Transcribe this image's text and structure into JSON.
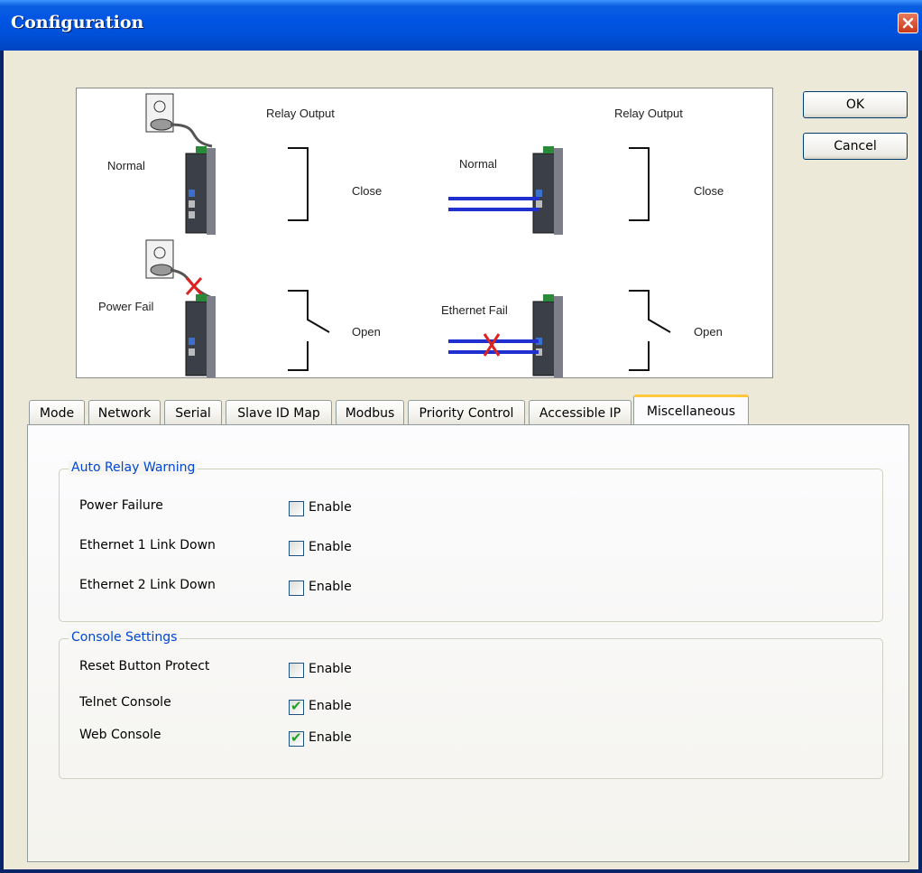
{
  "window": {
    "title": "Configuration",
    "close_icon": "close-icon"
  },
  "diagram": {
    "left": {
      "relay_output": "Relay Output",
      "normal": "Normal",
      "close": "Close",
      "power_fail": "Power Fail",
      "open": "Open"
    },
    "right": {
      "relay_output": "Relay Output",
      "normal": "Normal",
      "close": "Close",
      "ethernet_fail": "Ethernet Fail",
      "open": "Open"
    }
  },
  "buttons": {
    "ok": "OK",
    "cancel": "Cancel"
  },
  "tabs": [
    {
      "label": "Mode"
    },
    {
      "label": "Network"
    },
    {
      "label": "Serial"
    },
    {
      "label": "Slave ID Map"
    },
    {
      "label": "Modbus"
    },
    {
      "label": "Priority Control"
    },
    {
      "label": "Accessible IP"
    },
    {
      "label": "Miscellaneous",
      "active": true
    }
  ],
  "auto_relay": {
    "title": "Auto Relay Warning",
    "rows": [
      {
        "label": "Power Failure",
        "checkbox": "Enable",
        "checked": false
      },
      {
        "label": "Ethernet 1 Link Down",
        "checkbox": "Enable",
        "checked": false
      },
      {
        "label": "Ethernet 2 Link Down",
        "checkbox": "Enable",
        "checked": false
      }
    ]
  },
  "console": {
    "title": "Console Settings",
    "rows": [
      {
        "label": "Reset Button Protect",
        "checkbox": "Enable",
        "checked": false
      },
      {
        "label": "Telnet Console",
        "checkbox": "Enable",
        "checked": true
      },
      {
        "label": "Web Console",
        "checkbox": "Enable",
        "checked": true
      }
    ]
  },
  "colors": {
    "title_bar": "#0054E3",
    "group_title": "#0046D5",
    "active_tab_accent": "#FFC83C",
    "check": "#21A121"
  }
}
